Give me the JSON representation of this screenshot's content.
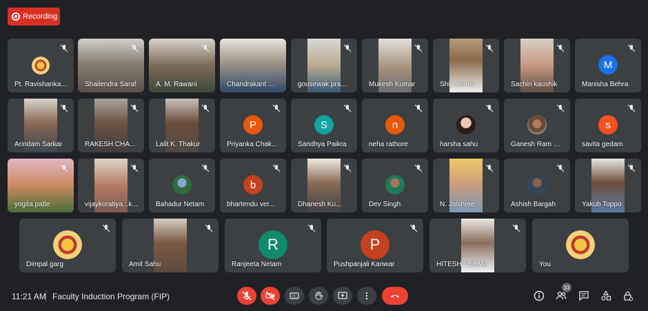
{
  "recording": {
    "label": "Recording"
  },
  "participants": [
    "Pt. Ravishanka...",
    "Shailendra Saraf",
    "A. M. Rawani",
    "Chandrakant ...",
    "gousewak pra...",
    "Mukesh Kumar",
    "Shiv Kumar",
    "Sachin kaushik",
    "Manisha Behra",
    "Arindam Sarkar",
    "RAKESH CHA...",
    "Lalit K. Thakur",
    "Priyanka Chak...",
    "Sandhya Paikra",
    "neha rathore",
    "harsha sahu",
    "Ganesh Ram N...",
    "savita gedam",
    "yogita patle",
    "vijaykoratiya...k...",
    "Bahadur Netam",
    "bhartendu ver...",
    "Dhanesh Ku...",
    "Dev Singh",
    "N. Jaishree",
    "Ashish Bargah",
    "Yakub Toppo",
    "Dimpal garg",
    "Amit Sahu",
    "Ranjeeta Netam",
    "Pushpanjali Kanwar",
    "HITESH VERMA",
    "You"
  ],
  "avatars": {
    "manisha": {
      "letter": "M",
      "color": "#1a73e8"
    },
    "priyanka": {
      "letter": "P",
      "color": "#e8590c"
    },
    "sandhya": {
      "letter": "S",
      "color": "#12a4a0"
    },
    "neha": {
      "letter": "n",
      "color": "#e8590c"
    },
    "savita": {
      "letter": "s",
      "color": "#f4511e"
    },
    "bhartendu": {
      "letter": "b",
      "color": "#c5411f"
    },
    "ranjeeta": {
      "letter": "R",
      "color": "#0f8a6a"
    },
    "pushpanjali": {
      "letter": "P",
      "color": "#c5411f"
    }
  },
  "bottom": {
    "time": "11:21 AM",
    "meeting_title": "Faculty Induction Program (FIP)",
    "participant_count": "33"
  },
  "icons": [
    "mic-off-icon",
    "camera-off-icon",
    "captions-icon",
    "raise-hand-icon",
    "present-icon",
    "more-icon",
    "end-call-icon",
    "info-icon",
    "people-icon",
    "chat-icon",
    "activities-icon",
    "host-controls-icon"
  ]
}
